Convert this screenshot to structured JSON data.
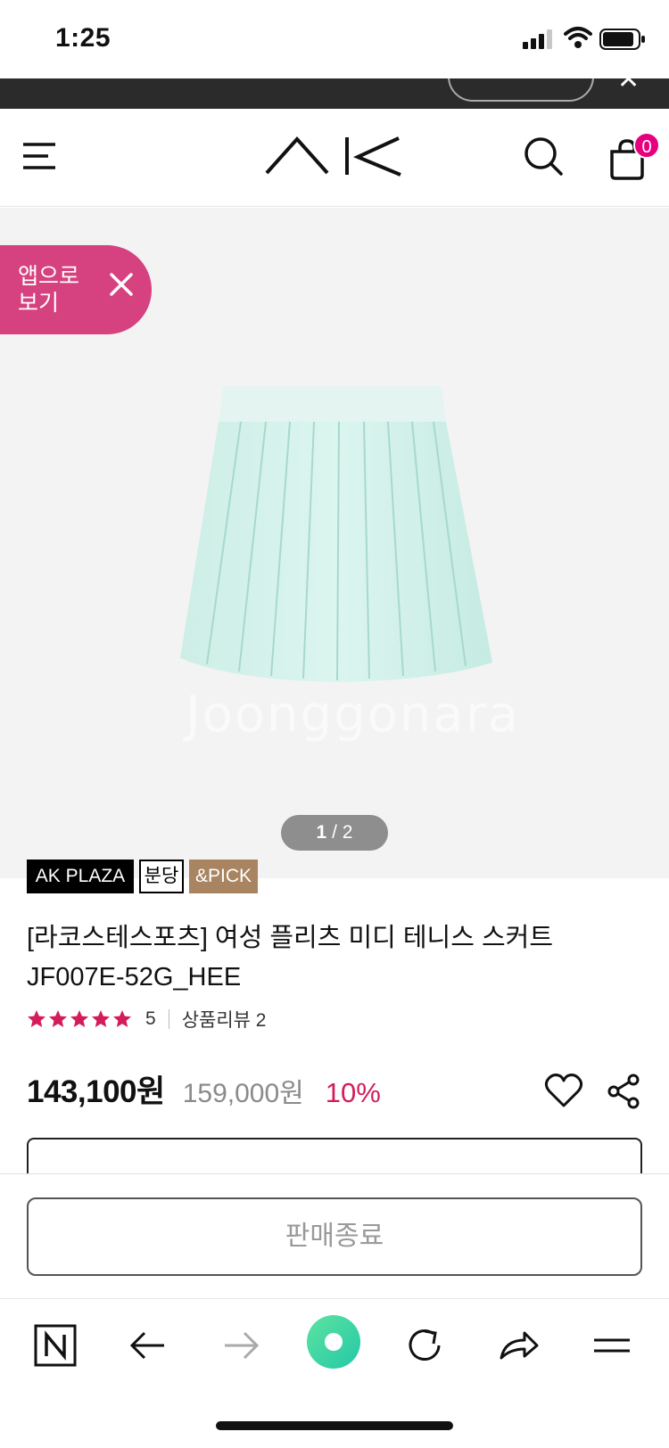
{
  "status_bar": {
    "time": "1:25"
  },
  "header": {
    "logo": "AK",
    "cart_count": "0"
  },
  "app_banner": {
    "label": "앱으로 보기"
  },
  "gallery": {
    "current": "1",
    "separator": " / ",
    "total": "2",
    "watermark": "Joonggonara"
  },
  "badges": {
    "store": "AK PLAZA",
    "branch": "분당",
    "tag": "&PICK"
  },
  "product": {
    "title": "[라코스테스포츠] 여성 플리츠 미디 테니스 스커트 JF007E-52G_HEE",
    "rating_score": "5",
    "review_label": "상품리뷰 2",
    "sale_price": "143,100원",
    "original_price": "159,000원",
    "discount": "10%"
  },
  "purchase": {
    "button_label": "판매종료"
  },
  "colors": {
    "accent": "#e6007e",
    "discount": "#d41c5c",
    "app_banner": "#d6417f",
    "browser_green": "#36d39a"
  },
  "browser_nav": {
    "icons": [
      "naver-icon",
      "back-arrow-icon",
      "forward-arrow-icon",
      "green-dot-icon",
      "refresh-icon",
      "share-arrow-icon",
      "menu-icon"
    ]
  }
}
